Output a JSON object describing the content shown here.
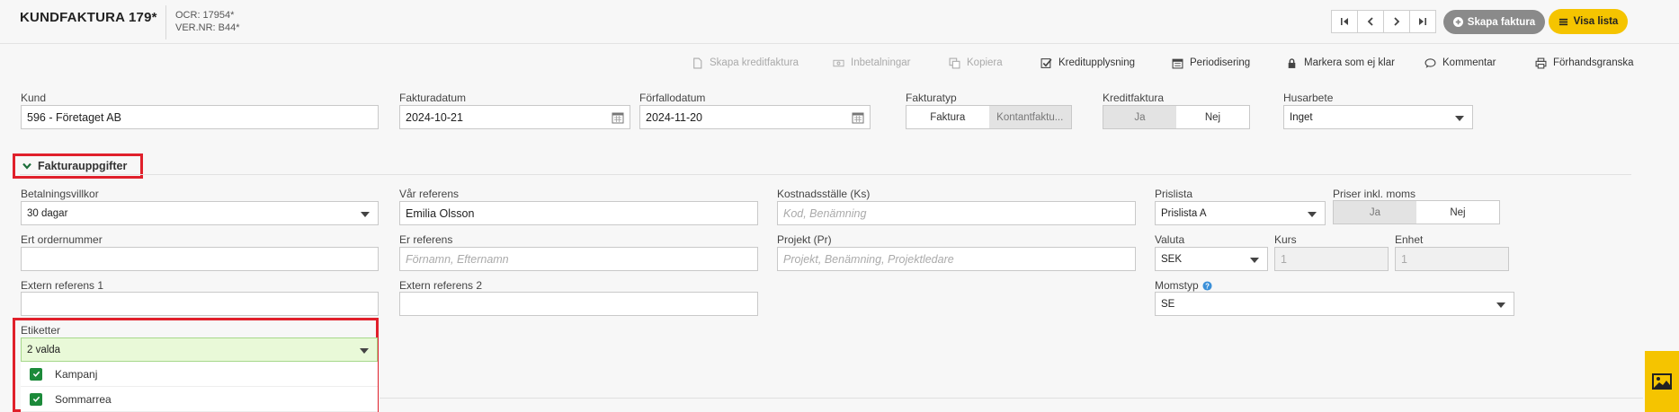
{
  "header": {
    "title": "KUNDFAKTURA 179*",
    "ocr": "OCR: 17954*",
    "vernr": "VER.NR: B44*",
    "create_label": "Skapa faktura",
    "list_label": "Visa lista"
  },
  "actions": {
    "credit_invoice": "Skapa kreditfaktura",
    "payments": "Inbetalningar",
    "copy": "Kopiera",
    "credit_report": "Kreditupplysning",
    "accrual": "Periodisering",
    "mark_not_ready": "Markera som ej klar",
    "comment": "Kommentar",
    "preview": "Förhandsgranska"
  },
  "top_fields": {
    "kund_label": "Kund",
    "kund_value": "596 - Företaget AB",
    "fakturadatum_label": "Fakturadatum",
    "fakturadatum_value": "2024-10-21",
    "forfallodatum_label": "Förfallodatum",
    "forfallodatum_value": "2024-11-20",
    "fakturatyp_label": "Fakturatyp",
    "fakturatyp_options": [
      "Faktura",
      "Kontantfaktu..."
    ],
    "kreditfaktura_label": "Kreditfaktura",
    "kreditfaktura_options": [
      "Ja",
      "Nej"
    ],
    "husarbete_label": "Husarbete",
    "husarbete_value": "Inget"
  },
  "section": {
    "title": "Fakturauppgifter"
  },
  "details": {
    "betalningsvillkor_label": "Betalningsvillkor",
    "betalningsvillkor_value": "30 dagar",
    "var_referens_label": "Vår referens",
    "var_referens_value": "Emilia Olsson",
    "kostnadsstalle_label": "Kostnadsställe (Ks)",
    "kostnadsstalle_placeholder": "Kod, Benämning",
    "prislista_label": "Prislista",
    "prislista_value": "Prislista A",
    "priser_label": "Priser inkl. moms",
    "priser_options": [
      "Ja",
      "Nej"
    ],
    "ert_ordernummer_label": "Ert ordernummer",
    "ert_ordernummer_value": "",
    "er_referens_label": "Er referens",
    "er_referens_placeholder": "Förnamn, Efternamn",
    "projekt_label": "Projekt (Pr)",
    "projekt_placeholder": "Projekt, Benämning, Projektledare",
    "valuta_label": "Valuta",
    "valuta_value": "SEK",
    "kurs_label": "Kurs",
    "kurs_value": "1",
    "enhet_label": "Enhet",
    "enhet_value": "1",
    "extern1_label": "Extern referens 1",
    "extern1_value": "",
    "extern2_label": "Extern referens 2",
    "extern2_value": "",
    "momstyp_label": "Momstyp",
    "momstyp_value": "SE",
    "etiketter_label": "Etiketter",
    "etiketter_value": "2 valda",
    "etiketter_options": [
      {
        "label": "Kampanj",
        "checked": true
      },
      {
        "label": "Sommarrea",
        "checked": true
      }
    ]
  },
  "colors": {
    "accent_yellow": "#f5c400",
    "highlight_red": "#e0202b",
    "check_green": "#1c8a3a",
    "selected_field_bg": "#e9f9d8"
  }
}
